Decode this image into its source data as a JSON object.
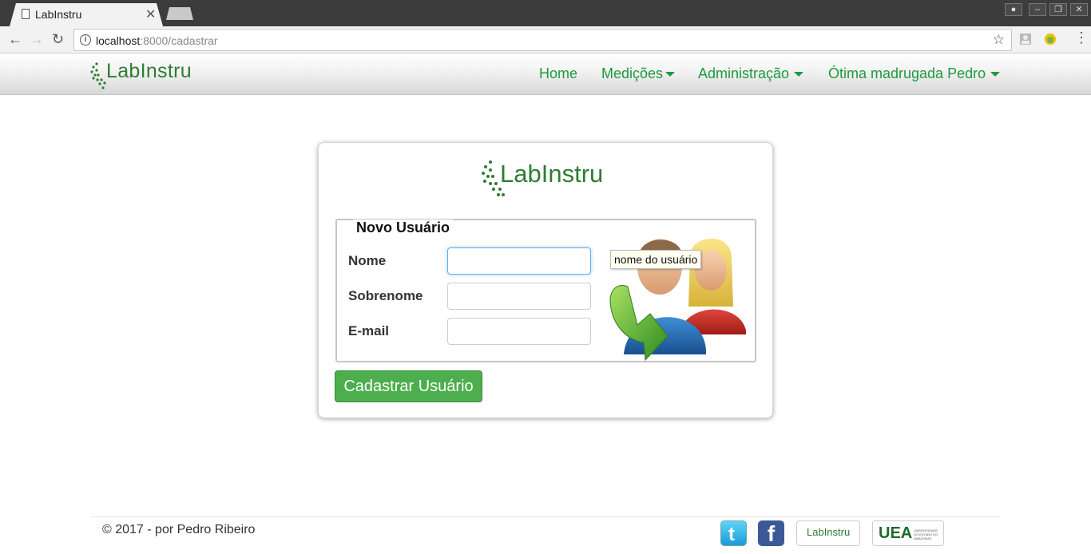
{
  "browser": {
    "tab_title": "LabInstru",
    "url_host": "localhost",
    "url_path": ":8000/cadastrar"
  },
  "nav": {
    "brand": "LabInstru",
    "items": [
      {
        "label": "Home"
      },
      {
        "label": "Medições"
      },
      {
        "label": "Administração"
      },
      {
        "label": "Ótima madrugada Pedro"
      }
    ]
  },
  "form": {
    "logo": "LabInstru",
    "legend": "Novo Usuário",
    "fields": [
      {
        "label": "Nome",
        "value": ""
      },
      {
        "label": "Sobrenome",
        "value": ""
      },
      {
        "label": "E-mail",
        "value": ""
      }
    ],
    "tooltip": "nome do usuário",
    "submit_label": "Cadastrar Usuário"
  },
  "footer": {
    "copyright": "© 2017 - por Pedro Ribeiro",
    "labinstru_badge": "LabInstru",
    "uea_badge": "UEA",
    "uea_subtext": "UNIVERSIDADE DO ESTADO DO AMAZONAS"
  },
  "colors": {
    "brand_green": "#2e7d32",
    "nav_link": "#1f9a3a",
    "button_green": "#4cae4c"
  }
}
